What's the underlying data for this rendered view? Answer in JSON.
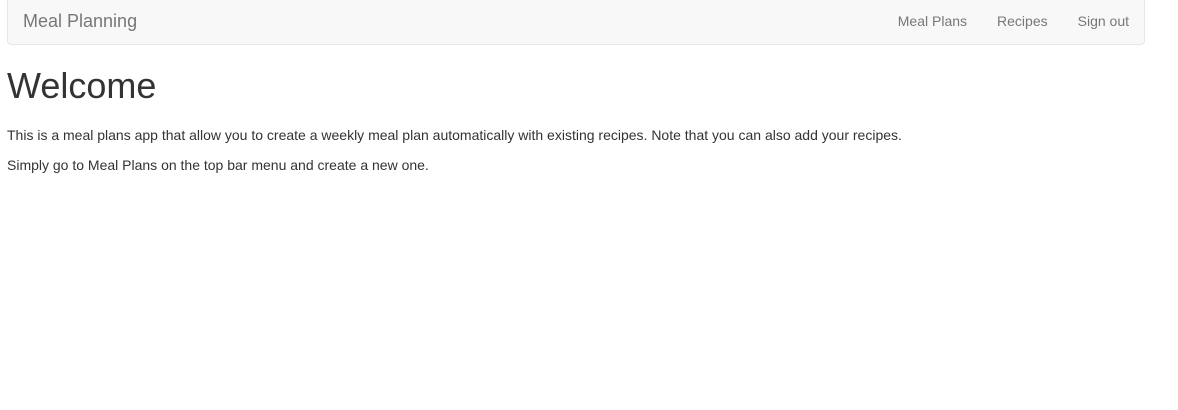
{
  "navbar": {
    "brand": "Meal Planning",
    "links": [
      {
        "label": "Meal Plans"
      },
      {
        "label": "Recipes"
      },
      {
        "label": "Sign out"
      }
    ]
  },
  "main": {
    "heading": "Welcome",
    "paragraphs": [
      "This is a meal plans app that allow you to create a weekly meal plan automatically with existing recipes. Note that you can also add your recipes.",
      "Simply go to Meal Plans on the top bar menu and create a new one."
    ]
  },
  "colors": {
    "navbar_bg": "#f8f8f8",
    "navbar_border": "#e7e7e7",
    "nav_text": "#777777",
    "body_text": "#333333"
  }
}
